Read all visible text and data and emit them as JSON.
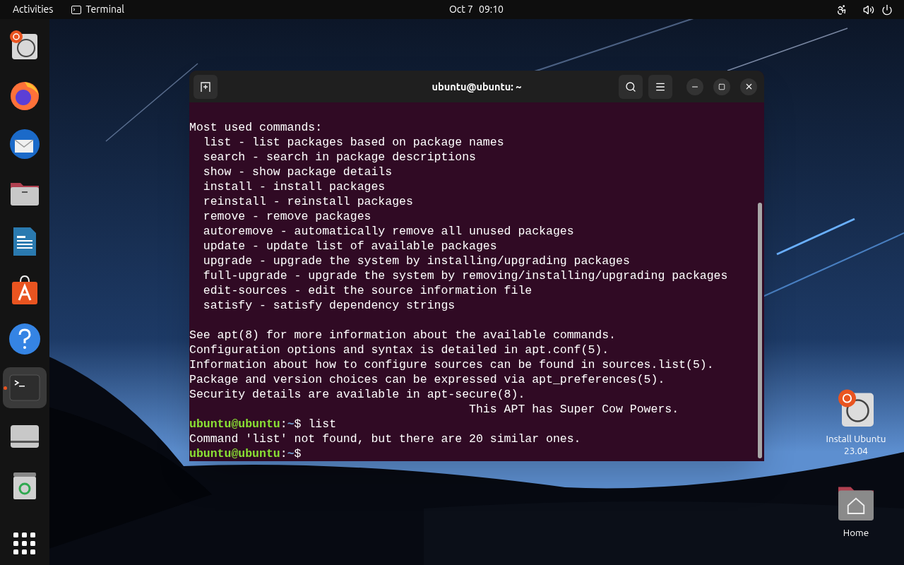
{
  "top_bar": {
    "activities": "Activities",
    "app_name": "Terminal",
    "date": "Oct 7",
    "time": "09:10"
  },
  "dock": {
    "items": [
      {
        "kind": "installer",
        "running": false
      },
      {
        "kind": "browser",
        "running": false
      },
      {
        "kind": "mail",
        "running": false
      },
      {
        "kind": "files",
        "running": false
      },
      {
        "kind": "writer",
        "running": false
      },
      {
        "kind": "store",
        "running": false
      },
      {
        "kind": "help",
        "running": false
      },
      {
        "kind": "terminal",
        "running": true
      },
      {
        "kind": "drive",
        "running": false
      },
      {
        "kind": "trash",
        "running": false
      },
      {
        "kind": "apps",
        "running": false
      }
    ]
  },
  "terminal": {
    "title": "ubuntu@ubuntu: ~",
    "lines": [
      {
        "kind": "text",
        "text": "Most used commands:"
      },
      {
        "kind": "text",
        "text": "  list - list packages based on package names"
      },
      {
        "kind": "text",
        "text": "  search - search in package descriptions"
      },
      {
        "kind": "text",
        "text": "  show - show package details"
      },
      {
        "kind": "text",
        "text": "  install - install packages"
      },
      {
        "kind": "text",
        "text": "  reinstall - reinstall packages"
      },
      {
        "kind": "text",
        "text": "  remove - remove packages"
      },
      {
        "kind": "text",
        "text": "  autoremove - automatically remove all unused packages"
      },
      {
        "kind": "text",
        "text": "  update - update list of available packages"
      },
      {
        "kind": "text",
        "text": "  upgrade - upgrade the system by installing/upgrading packages"
      },
      {
        "kind": "text",
        "text": "  full-upgrade - upgrade the system by removing/installing/upgrading packages"
      },
      {
        "kind": "text",
        "text": "  edit-sources - edit the source information file"
      },
      {
        "kind": "text",
        "text": "  satisfy - satisfy dependency strings"
      },
      {
        "kind": "blank"
      },
      {
        "kind": "text",
        "text": "See apt(8) for more information about the available commands."
      },
      {
        "kind": "text",
        "text": "Configuration options and syntax is detailed in apt.conf(5)."
      },
      {
        "kind": "text",
        "text": "Information about how to configure sources can be found in sources.list(5)."
      },
      {
        "kind": "text",
        "text": "Package and version choices can be expressed via apt_preferences(5)."
      },
      {
        "kind": "text",
        "text": "Security details are available in apt-secure(8)."
      },
      {
        "kind": "text",
        "text": "                                        This APT has Super Cow Powers."
      },
      {
        "kind": "prompt",
        "user": "ubuntu@ubuntu",
        "separator": ":",
        "path": "~",
        "sign": "$",
        "command": "list"
      },
      {
        "kind": "text",
        "text": "Command 'list' not found, but there are 20 similar ones."
      },
      {
        "kind": "prompt",
        "user": "ubuntu@ubuntu",
        "separator": ":",
        "path": "~",
        "sign": "$"
      }
    ]
  },
  "desktop_icons": [
    {
      "kind": "installer",
      "label": "Install Ubuntu 23.04"
    },
    {
      "kind": "home",
      "label": "Home"
    }
  ]
}
